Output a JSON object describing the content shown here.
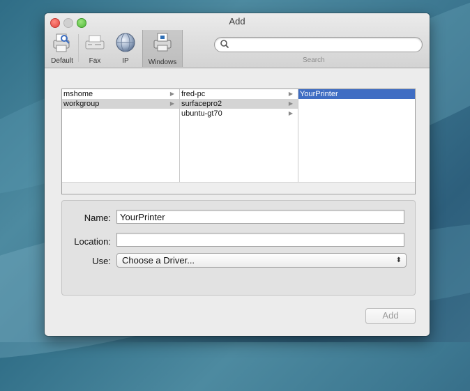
{
  "window": {
    "title": "Add"
  },
  "toolbar": {
    "buttons": [
      {
        "label": "Default",
        "icon": "printer-magnifier-icon"
      },
      {
        "label": "Fax",
        "icon": "fax-icon"
      },
      {
        "label": "IP",
        "icon": "globe-icon"
      },
      {
        "label": "Windows",
        "icon": "windows-printer-icon",
        "selected": true
      }
    ]
  },
  "search": {
    "placeholder": "",
    "label": "Search"
  },
  "browser": {
    "columns": [
      {
        "items": [
          {
            "label": "mshome"
          },
          {
            "label": "workgroup",
            "selected": true
          }
        ]
      },
      {
        "items": [
          {
            "label": "fred-pc"
          },
          {
            "label": "surfacepro2",
            "selected": true
          },
          {
            "label": "ubuntu-gt70"
          }
        ]
      },
      {
        "items": [
          {
            "label": "YourPrinter",
            "selected": true
          }
        ]
      }
    ]
  },
  "form": {
    "name_label": "Name:",
    "name_value": "YourPrinter",
    "location_label": "Location:",
    "location_value": "",
    "use_label": "Use:",
    "use_value": "Choose a Driver..."
  },
  "footer": {
    "add_label": "Add"
  },
  "colors": {
    "selection_blue": "#3f6dc3",
    "close_red": "#e0443e",
    "max_green": "#4fb838"
  }
}
